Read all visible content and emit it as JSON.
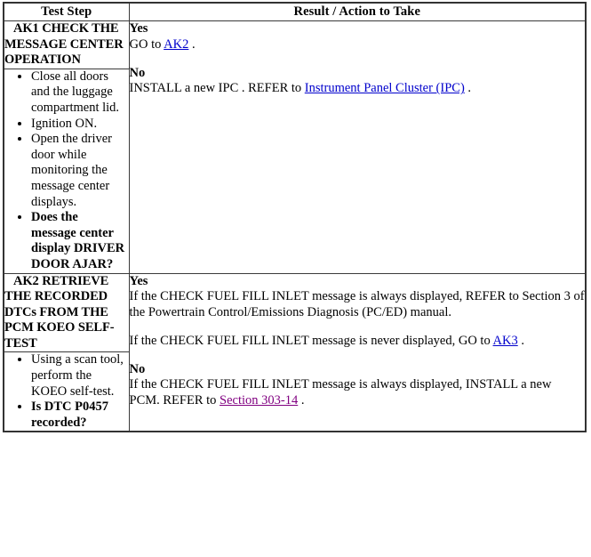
{
  "table": {
    "headers": {
      "step": "Test Step",
      "result": "Result / Action to Take"
    },
    "rows": [
      {
        "id": "ak1",
        "title": "AK1 CHECK THE MESSAGE CENTER OPERATION",
        "steps": [
          {
            "text": "Close all doors and the luggage compartment lid.",
            "bold": false
          },
          {
            "text": "Ignition ON.",
            "bold": false
          },
          {
            "text": "Open the driver door while monitoring the message center displays.",
            "bold": false
          },
          {
            "text": "Does the message center display DRIVER DOOR AJAR?",
            "bold": true
          }
        ],
        "result": {
          "yes_label": "Yes",
          "yes_lines": [
            {
              "pre": "GO to ",
              "link": "AK2",
              "link_style": "blue",
              "post": " ."
            }
          ],
          "no_label": "No",
          "no_lines": [
            {
              "pre": "INSTALL a new IPC . REFER to ",
              "link": "Instrument Panel Cluster (IPC)",
              "link_style": "blue",
              "post": " ."
            }
          ]
        }
      },
      {
        "id": "ak2",
        "title": "AK2 RETRIEVE THE RECORDED DTCs FROM THE PCM KOEO SELF-TEST",
        "steps": [
          {
            "text": "Using a scan tool, perform the KOEO self-test.",
            "bold": false
          },
          {
            "text": "Is DTC P0457 recorded?",
            "bold": true
          }
        ],
        "result": {
          "yes_label": "Yes",
          "yes_lines": [
            {
              "pre": "If the CHECK FUEL FILL INLET message is always displayed, REFER to Section 3 of the Powertrain Control/Emissions Diagnosis (PC/ED) manual.",
              "link": "",
              "link_style": "",
              "post": ""
            },
            {
              "pre": "If the CHECK FUEL FILL INLET message is never displayed, GO to ",
              "link": "AK3",
              "link_style": "blue",
              "post": " ."
            }
          ],
          "no_label": "No",
          "no_lines": [
            {
              "pre": "If the CHECK FUEL FILL INLET message is always displayed, INSTALL a new PCM. REFER to ",
              "link": "Section 303-14",
              "link_style": "visited",
              "post": " ."
            }
          ]
        }
      }
    ]
  },
  "colors": {
    "link": "#0000cc",
    "visited_link": "#800080",
    "border": "#333333",
    "text": "#000000",
    "background": "#ffffff"
  }
}
